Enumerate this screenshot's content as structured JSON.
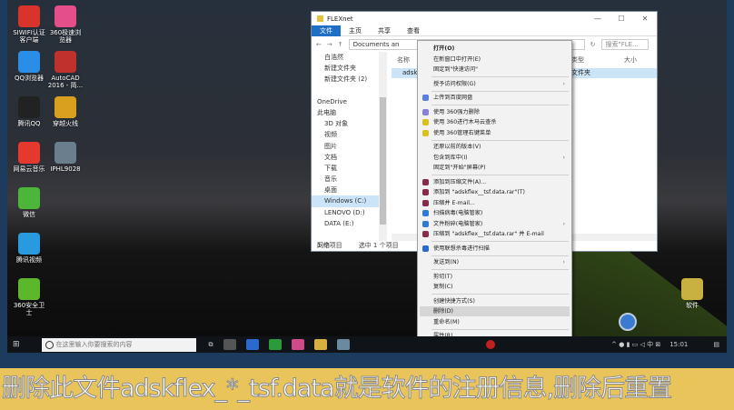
{
  "desktop": {
    "icons": [
      {
        "label": "SIWIFI认证客户端",
        "color": "#d9342b"
      },
      {
        "label": "360极速浏览器",
        "color": "#e44f8a"
      },
      {
        "label": "QQ浏览器",
        "color": "#2a8ee8"
      },
      {
        "label": "AutoCAD 2016 - 简...",
        "color": "#c0302c"
      },
      {
        "label": "腾讯QQ",
        "color": "#222"
      },
      {
        "label": "穿越火线",
        "color": "#d9a020"
      },
      {
        "label": "网易云音乐",
        "color": "#e6392e"
      },
      {
        "label": "IPHL9028",
        "color": "#6a7e8e"
      },
      {
        "label": "微信",
        "color": "#4cb53a"
      },
      {
        "label": "腾讯视频",
        "color": "#2a9ae0"
      },
      {
        "label": "360安全卫士",
        "color": "#5cb82a"
      }
    ],
    "right_icon": {
      "label": "软件",
      "color": "#c9b040"
    }
  },
  "explorer": {
    "title": "FLEXnet",
    "tabs": [
      "文件",
      "主页",
      "共享",
      "查看"
    ],
    "address": "Documents an",
    "search_placeholder": "搜索\"FLE...",
    "nav": [
      "白浩然",
      "新建文件夹",
      "新建文件夹 (2)",
      "",
      "OneDrive",
      "此电脑",
      "3D 对象",
      "视频",
      "图片",
      "文档",
      "下载",
      "音乐",
      "桌面",
      "Windows (C:)",
      "LENOVO (D:)",
      "DATA (E:)",
      "",
      "网络"
    ],
    "columns": [
      "名称",
      "类型",
      "大小"
    ],
    "row": {
      "name": "adskf",
      "type": "文件夹"
    },
    "status": [
      "1 个项目",
      "选中 1 个项目"
    ]
  },
  "menu": {
    "items": [
      {
        "label": "打开(O)",
        "bold": true
      },
      {
        "label": "在新窗口中打开(E)"
      },
      {
        "label": "固定到\"快速访问\""
      },
      {
        "sep": true
      },
      {
        "label": "授予访问权限(G)",
        "sub": true
      },
      {
        "sep": true
      },
      {
        "label": "上传到百度网盘",
        "icon": "baidu-netdisk-icon",
        "color": "#5b7de0"
      },
      {
        "sep": true
      },
      {
        "label": "使用 360强力删除",
        "icon": "360-delete-icon",
        "color": "#8a7fd6"
      },
      {
        "label": "使用 360进行木马云查杀",
        "icon": "360-scan-icon",
        "color": "#d8c020"
      },
      {
        "label": "使用 360管理右键菜单",
        "icon": "360-menu-icon",
        "color": "#d8c020"
      },
      {
        "sep": true
      },
      {
        "label": "还原以前的版本(V)"
      },
      {
        "label": "包含到库中(I)",
        "sub": true
      },
      {
        "label": "固定到\"开始\"屏幕(P)"
      },
      {
        "sep": true
      },
      {
        "label": "添加到压缩文件(A)...",
        "icon": "winrar-icon",
        "color": "#8a2a4a"
      },
      {
        "label": "添加到 \"adskflex__tsf.data.rar\"(T)",
        "icon": "winrar-icon",
        "color": "#8a2a4a"
      },
      {
        "label": "压缩并 E-mail...",
        "icon": "winrar-icon",
        "color": "#8a2a4a"
      },
      {
        "label": "扫描病毒(电脑管家)",
        "icon": "pc-manager-icon",
        "color": "#2f7ad8"
      },
      {
        "label": "文件粉碎(电脑管家)",
        "icon": "pc-manager-icon",
        "color": "#2f7ad8",
        "sub": true
      },
      {
        "label": "压缩到 \"adskflex__tsf.data.rar\" 并 E-mail",
        "icon": "winrar-icon",
        "color": "#8a2a4a"
      },
      {
        "sep": true
      },
      {
        "label": "使用联想杀毒进行扫描",
        "icon": "lenovo-antivirus-icon",
        "color": "#2a6ad0"
      },
      {
        "sep": true
      },
      {
        "label": "发送到(N)",
        "sub": true
      },
      {
        "sep": true
      },
      {
        "label": "剪切(T)"
      },
      {
        "label": "复制(C)"
      },
      {
        "sep": true
      },
      {
        "label": "创建快捷方式(S)"
      },
      {
        "label": "删除(D)",
        "highlight": true
      },
      {
        "label": "重命名(M)"
      },
      {
        "sep": true
      },
      {
        "label": "属性(R)"
      }
    ]
  },
  "taskbar": {
    "search_placeholder": "在这里输入你要搜索的内容",
    "time": "15:01"
  },
  "caption": "删除此文件adskflex_*_tsf.data就是软件的注册信息,删除后重置"
}
